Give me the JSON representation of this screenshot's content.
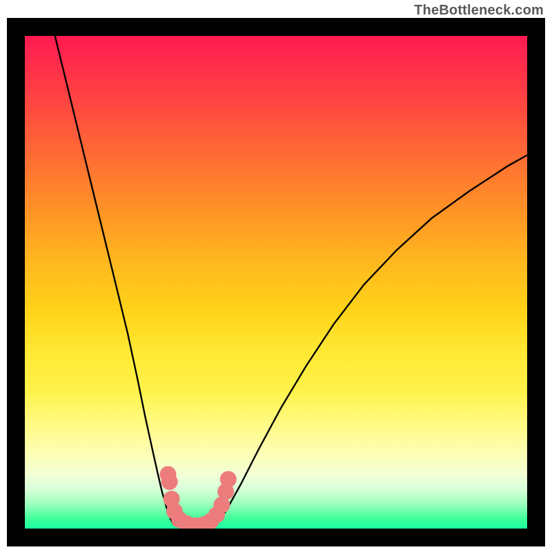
{
  "watermark": "TheBottleneck.com",
  "chart_data": {
    "type": "line",
    "title": "",
    "xlabel": "",
    "ylabel": "",
    "xlim": [
      0,
      1
    ],
    "ylim": [
      0,
      1
    ],
    "series": [
      {
        "name": "left-branch",
        "x": [
          0.06,
          0.09,
          0.12,
          0.15,
          0.18,
          0.205,
          0.225,
          0.24,
          0.254,
          0.265,
          0.273,
          0.28,
          0.285,
          0.29,
          0.295,
          0.3
        ],
        "y": [
          1.0,
          0.875,
          0.75,
          0.625,
          0.5,
          0.395,
          0.3,
          0.225,
          0.16,
          0.11,
          0.075,
          0.05,
          0.032,
          0.02,
          0.01,
          0.005
        ]
      },
      {
        "name": "trough",
        "x": [
          0.3,
          0.32,
          0.34,
          0.36,
          0.38
        ],
        "y": [
          0.005,
          0.0,
          0.0,
          0.0,
          0.005
        ]
      },
      {
        "name": "right-branch",
        "x": [
          0.38,
          0.4,
          0.43,
          0.465,
          0.51,
          0.56,
          0.615,
          0.675,
          0.74,
          0.81,
          0.885,
          0.96,
          1.0
        ],
        "y": [
          0.005,
          0.035,
          0.09,
          0.16,
          0.245,
          0.33,
          0.415,
          0.495,
          0.565,
          0.63,
          0.685,
          0.735,
          0.758
        ]
      }
    ],
    "markers": {
      "name": "rose-dots",
      "color": "#ed7d7d",
      "points": [
        {
          "x": 0.285,
          "y": 0.11
        },
        {
          "x": 0.288,
          "y": 0.095
        },
        {
          "x": 0.292,
          "y": 0.06
        },
        {
          "x": 0.298,
          "y": 0.035
        },
        {
          "x": 0.308,
          "y": 0.018
        },
        {
          "x": 0.322,
          "y": 0.01
        },
        {
          "x": 0.338,
          "y": 0.006
        },
        {
          "x": 0.355,
          "y": 0.008
        },
        {
          "x": 0.37,
          "y": 0.015
        },
        {
          "x": 0.382,
          "y": 0.028
        },
        {
          "x": 0.392,
          "y": 0.048
        },
        {
          "x": 0.4,
          "y": 0.075
        },
        {
          "x": 0.405,
          "y": 0.1
        }
      ]
    },
    "background": {
      "type": "vertical-gradient",
      "stops": [
        {
          "pos": 0.0,
          "color": "#ff1a51"
        },
        {
          "pos": 0.5,
          "color": "#ffd41a"
        },
        {
          "pos": 0.82,
          "color": "#fffa85"
        },
        {
          "pos": 1.0,
          "color": "#1cffa0"
        }
      ]
    }
  }
}
